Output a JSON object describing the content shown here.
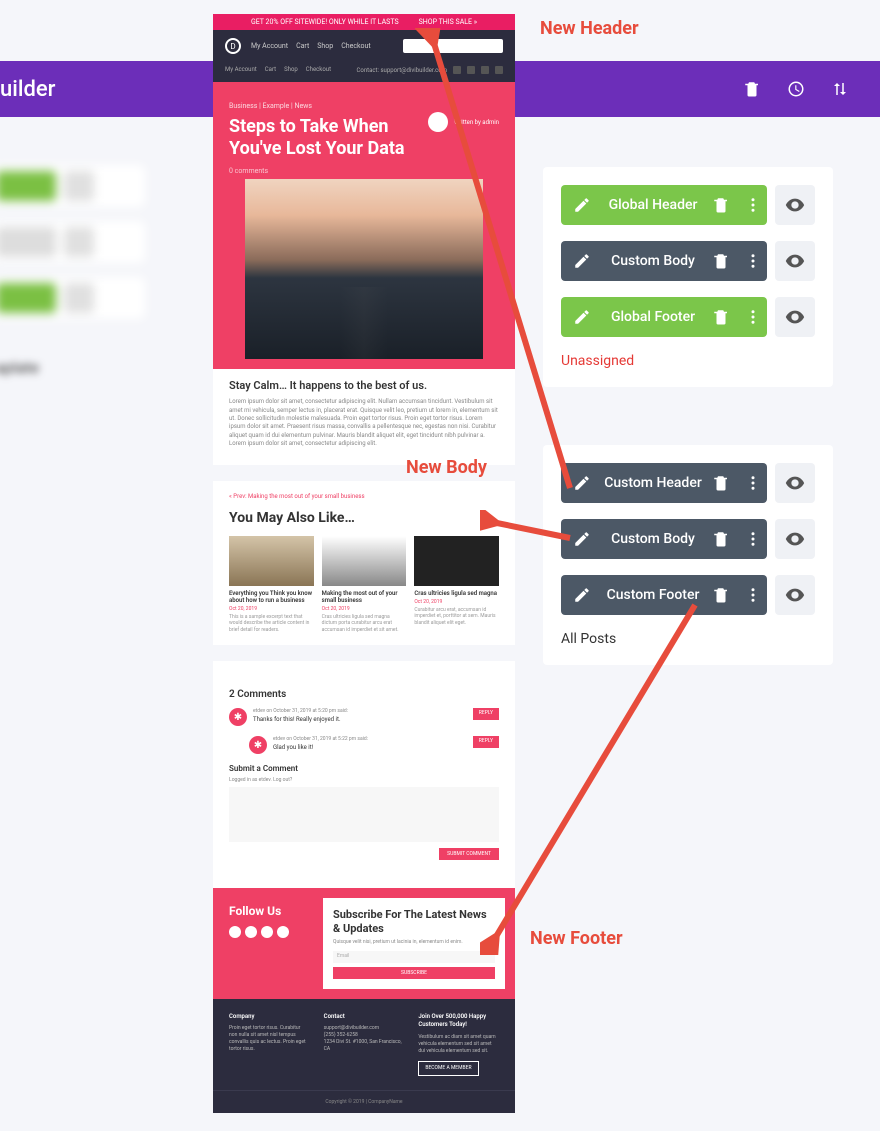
{
  "topbar": {
    "title": "uilder"
  },
  "annotation": {
    "header": "New Header",
    "body": "New Body",
    "footer": "New Footer"
  },
  "preview": {
    "promo": {
      "left": "GET 20% OFF SITEWIDE! ONLY WHILE IT LASTS",
      "right": "SHOP THIS SALE »"
    },
    "nav": {
      "links": [
        "My Account",
        "Cart",
        "Shop",
        "Checkout"
      ]
    },
    "navsub": {
      "left": [
        "My Account",
        "Cart",
        "Shop",
        "Checkout"
      ],
      "contact": "Contact: support@divibuilder.com"
    },
    "hero": {
      "crumb": "Business | Example | News",
      "title": "Steps to Take When You've Lost Your Data",
      "author": "Written by admin",
      "meta": "0 comments"
    },
    "article": {
      "h": "Stay Calm… It happens to the best of us.",
      "p": "Lorem ipsum dolor sit amet, consectetur adipiscing elit. Nullam accumsan tincidunt. Vestibulum sit amet mi vehicula, semper lectus in, placerat erat. Quisque velit leo, pretium ut lorem in, elementum sit ut. Donec sollicitudin molestie malesuada. Proin eget tortor risus. Proin eget tortor risus. Lorem ipsum dolor sit amet. Praesent risus massa, convallis a pellentesque nec, egestas non nisi. Curabitur aliquet quam id dui elementum pulvinar. Mauris blandit aliquet elit, eget tincidunt nibh pulvinar a. Lorem ipsum dolor sit amet, consectetur adipiscing elit."
    },
    "related": {
      "back": "« Prev: Making the most out of your small business",
      "h": "You May Also Like…",
      "items": [
        {
          "t": "Everything you Think you know about how to run a business",
          "d": "Oct 20, 2019",
          "e": "This is a sample excerpt text that would describe the article content in brief detail for readers."
        },
        {
          "t": "Making the most out of your small business",
          "d": "Oct 20, 2019",
          "e": "Cras ultricies ligula sed magna dictum porta curabitur arcu erat accumsan id imperdiet et sit amet."
        },
        {
          "t": "Cras ultricies ligula sed magna",
          "d": "Oct 20, 2019",
          "e": "Curabitur arcu erat, accumsan id imperdiet et, porttitor at sem. Mauris blandit aliquet elit eget."
        }
      ]
    },
    "comments": {
      "h": "2 Comments",
      "list": [
        {
          "meta": "etdev on October 31, 2019 at 5:20 pm said:",
          "text": "Thanks for this! Really enjoyed it.",
          "btn": "REPLY"
        },
        {
          "meta": "etdev on October 31, 2019 at 5:22 pm said:",
          "text": "Glad you like it!",
          "btn": "REPLY"
        }
      ],
      "submit_h": "Submit a Comment",
      "caption": "Logged in as etdev. Log out?",
      "submit_btn": "SUBMIT COMMENT"
    },
    "footer": {
      "follow": "Follow Us",
      "sub_h": "Subscribe For The Latest News & Updates",
      "sub_p": "Quisque velit nisi, pretium ut lacinia in, elementum id enim.",
      "email_ph": "Email",
      "sub_btn": "SUBSCRIBE",
      "cols": [
        {
          "h": "Company",
          "p": "Proin eget tortor risus. Curabitur non nulla sit amet nisl tempus convallis quis ac lectus. Proin eget tortor risus."
        },
        {
          "h": "Contact",
          "p": "support@divibuilder.com\n(255) 352-6258\n1234 Divi St. #1000, San Francisco, CA"
        },
        {
          "h": "Join Over 500,000 Happy Customers Today!",
          "p": "Vestibulum ac diam sit amet quam vehicula elementum sed sit amet dui vehicula elementum sed sit.",
          "btn": "BECOME A MEMBER"
        }
      ],
      "copyright": "Copyright © 2019 | CompanyName"
    }
  },
  "panels": {
    "a": {
      "rows": [
        {
          "label": "Global Header",
          "color": "green"
        },
        {
          "label": "Custom Body",
          "color": "dark"
        },
        {
          "label": "Global Footer",
          "color": "green"
        }
      ],
      "caption": "Unassigned"
    },
    "b": {
      "rows": [
        {
          "label": "Custom Header",
          "color": "dark"
        },
        {
          "label": "Custom Body",
          "color": "dark"
        },
        {
          "label": "Custom Footer",
          "color": "dark"
        }
      ],
      "caption": "All Posts"
    }
  }
}
